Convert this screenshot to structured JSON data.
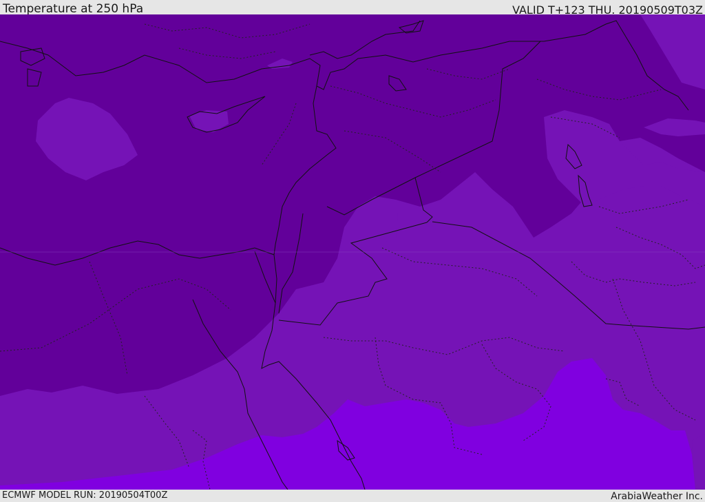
{
  "header": {
    "title": "Temperature at 250 hPa",
    "valid": "VALID T+123 THU. 20190509T03Z"
  },
  "footer": {
    "model_run": "ECMWF MODEL RUN: 20190504T00Z",
    "credit": "ArabiaWeather Inc."
  },
  "map": {
    "field": "temperature",
    "level": "250 hPa",
    "colors": {
      "coldest": "#62009a",
      "cold": "#7513b6",
      "warm": "#8000e0",
      "coastline": "#111111",
      "border": "#111111"
    }
  }
}
